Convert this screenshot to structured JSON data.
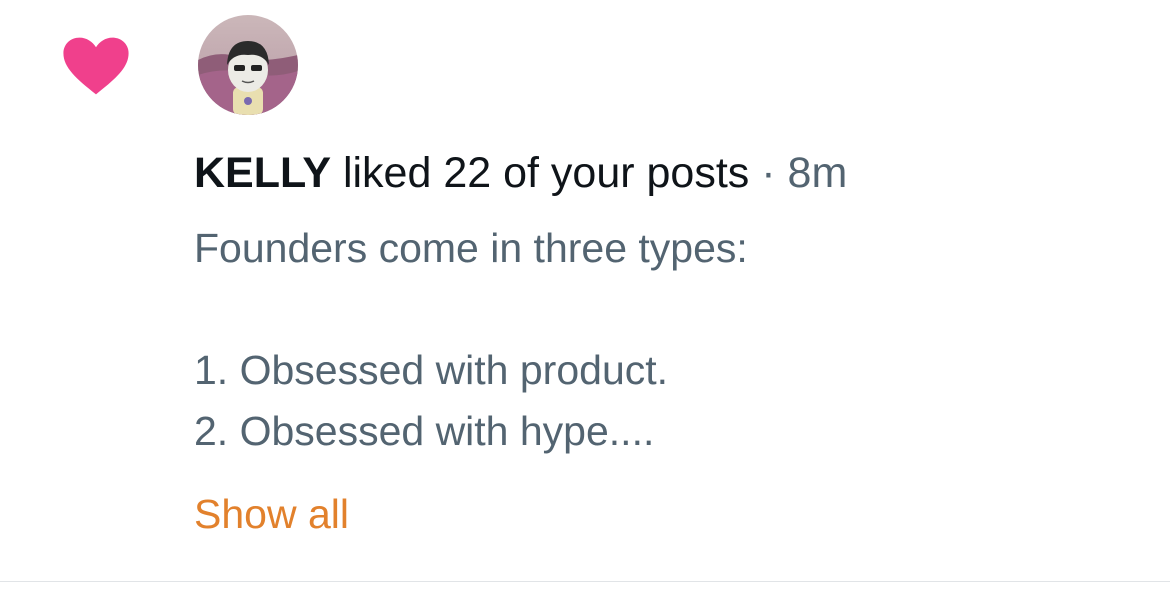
{
  "notification": {
    "icon": "heart-icon",
    "icon_color": "#f0408c",
    "user_name": "KELLY",
    "action_text": "liked 22 of your posts",
    "separator": "·",
    "time": "8m",
    "post_lines": [
      "Founders come in three types:",
      "",
      "1. Obsessed with product.",
      "2. Obsessed with hype...."
    ],
    "show_all_label": "Show all",
    "link_color": "#e2812c"
  }
}
